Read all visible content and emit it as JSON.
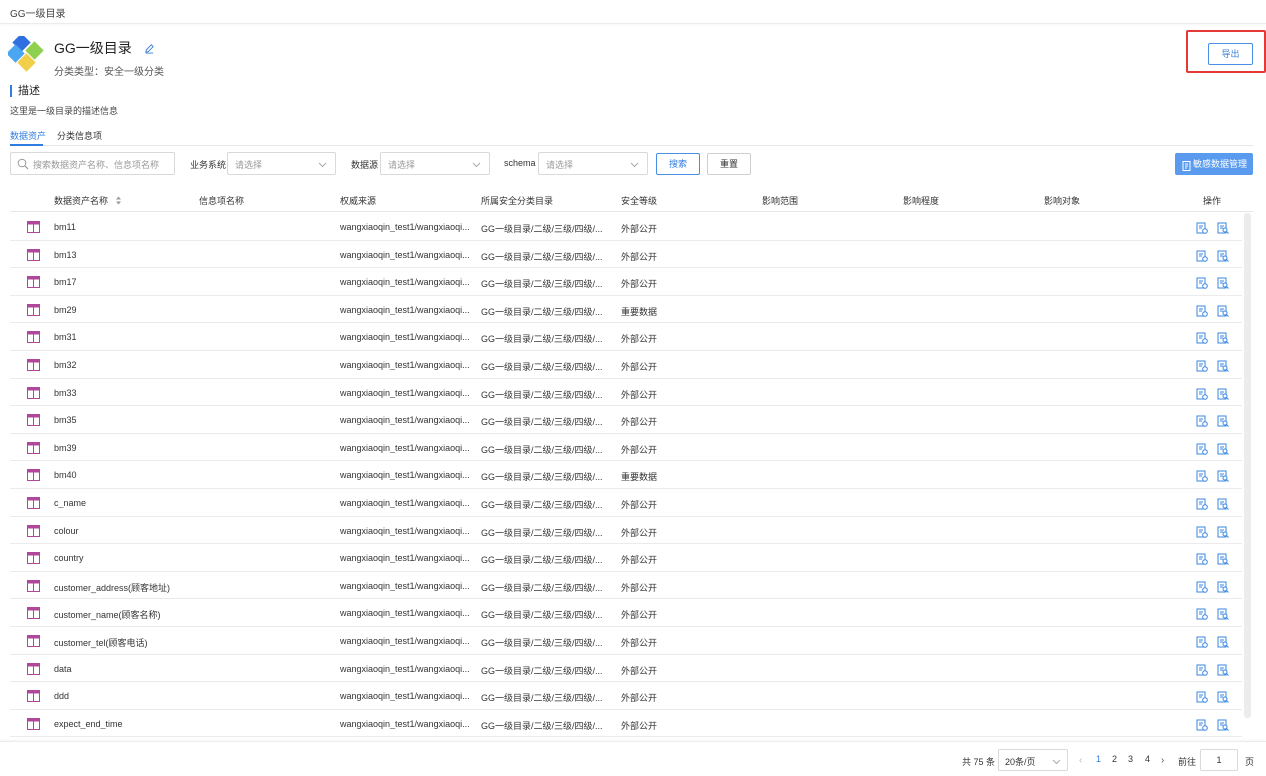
{
  "breadcrumb": "GG一级目录",
  "header": {
    "title": "GG一级目录",
    "subtitle": "分类类型：安全一级分类",
    "export_label": "导出"
  },
  "description": {
    "title": "描述",
    "text": "这里是一级目录的描述信息"
  },
  "tabs": [
    {
      "label": "数据资产",
      "active": true
    },
    {
      "label": "分类信息项",
      "active": false
    }
  ],
  "filters": {
    "search_placeholder": "搜索数据资产名称、信息项名称",
    "business_label": "业务系统",
    "business_placeholder": "请选择",
    "datasource_label": "数据源",
    "datasource_placeholder": "请选择",
    "schema_label": "schema",
    "schema_placeholder": "请选择",
    "search_button": "搜索",
    "reset_button": "重置",
    "sensitive_button": "敏感数据管理"
  },
  "table": {
    "columns": [
      "数据资产名称",
      "信息项名称",
      "权威来源",
      "所属安全分类目录",
      "安全等级",
      "影响范围",
      "影响程度",
      "影响对象",
      "操作"
    ],
    "rows": [
      {
        "name": "bm11",
        "item": "",
        "source": "wangxiaoqin_test1/wangxiaoqi...",
        "catalog": "GG一级目录/二级/三级/四级/...",
        "level": "外部公开"
      },
      {
        "name": "bm13",
        "item": "",
        "source": "wangxiaoqin_test1/wangxiaoqi...",
        "catalog": "GG一级目录/二级/三级/四级/...",
        "level": "外部公开"
      },
      {
        "name": "bm17",
        "item": "",
        "source": "wangxiaoqin_test1/wangxiaoqi...",
        "catalog": "GG一级目录/二级/三级/四级/...",
        "level": "外部公开"
      },
      {
        "name": "bm29",
        "item": "",
        "source": "wangxiaoqin_test1/wangxiaoqi...",
        "catalog": "GG一级目录/二级/三级/四级/...",
        "level": "重要数据"
      },
      {
        "name": "bm31",
        "item": "",
        "source": "wangxiaoqin_test1/wangxiaoqi...",
        "catalog": "GG一级目录/二级/三级/四级/...",
        "level": "外部公开"
      },
      {
        "name": "bm32",
        "item": "",
        "source": "wangxiaoqin_test1/wangxiaoqi...",
        "catalog": "GG一级目录/二级/三级/四级/...",
        "level": "外部公开"
      },
      {
        "name": "bm33",
        "item": "",
        "source": "wangxiaoqin_test1/wangxiaoqi...",
        "catalog": "GG一级目录/二级/三级/四级/...",
        "level": "外部公开"
      },
      {
        "name": "bm35",
        "item": "",
        "source": "wangxiaoqin_test1/wangxiaoqi...",
        "catalog": "GG一级目录/二级/三级/四级/...",
        "level": "外部公开"
      },
      {
        "name": "bm39",
        "item": "",
        "source": "wangxiaoqin_test1/wangxiaoqi...",
        "catalog": "GG一级目录/二级/三级/四级/...",
        "level": "外部公开"
      },
      {
        "name": "bm40",
        "item": "",
        "source": "wangxiaoqin_test1/wangxiaoqi...",
        "catalog": "GG一级目录/二级/三级/四级/...",
        "level": "重要数据"
      },
      {
        "name": "c_name",
        "item": "",
        "source": "wangxiaoqin_test1/wangxiaoqi...",
        "catalog": "GG一级目录/二级/三级/四级/...",
        "level": "外部公开"
      },
      {
        "name": "colour",
        "item": "",
        "source": "wangxiaoqin_test1/wangxiaoqi...",
        "catalog": "GG一级目录/二级/三级/四级/...",
        "level": "外部公开"
      },
      {
        "name": "country",
        "item": "",
        "source": "wangxiaoqin_test1/wangxiaoqi...",
        "catalog": "GG一级目录/二级/三级/四级/...",
        "level": "外部公开"
      },
      {
        "name": "customer_address(顾客地址)",
        "item": "",
        "source": "wangxiaoqin_test1/wangxiaoqi...",
        "catalog": "GG一级目录/二级/三级/四级/...",
        "level": "外部公开"
      },
      {
        "name": "customer_name(顾客名称)",
        "item": "",
        "source": "wangxiaoqin_test1/wangxiaoqi...",
        "catalog": "GG一级目录/二级/三级/四级/...",
        "level": "外部公开"
      },
      {
        "name": "customer_tel(顾客电话)",
        "item": "",
        "source": "wangxiaoqin_test1/wangxiaoqi...",
        "catalog": "GG一级目录/二级/三级/四级/...",
        "level": "外部公开"
      },
      {
        "name": "data",
        "item": "",
        "source": "wangxiaoqin_test1/wangxiaoqi...",
        "catalog": "GG一级目录/二级/三级/四级/...",
        "level": "外部公开"
      },
      {
        "name": "ddd",
        "item": "",
        "source": "wangxiaoqin_test1/wangxiaoqi...",
        "catalog": "GG一级目录/二级/三级/四级/...",
        "level": "外部公开"
      },
      {
        "name": "expect_end_time",
        "item": "",
        "source": "wangxiaoqin_test1/wangxiaoqi...",
        "catalog": "GG一级目录/二级/三级/四级/...",
        "level": "外部公开"
      }
    ]
  },
  "pagination": {
    "total": "共 75 条",
    "page_size": "20条/页",
    "pages": [
      "1",
      "2",
      "3",
      "4"
    ],
    "current": "1",
    "goto_label": "前往",
    "goto_value": "1",
    "page_suffix": "页"
  },
  "colors": {
    "accent": "#2f7de1",
    "highlight": "#e53935",
    "table_icon": "#b0479a"
  },
  "icons": {
    "logo": "diamond-logo-icon",
    "edit": "pencil-icon",
    "search": "search-icon",
    "table": "table-icon",
    "row_actions": [
      "edit-doc-icon",
      "view-doc-icon"
    ]
  }
}
